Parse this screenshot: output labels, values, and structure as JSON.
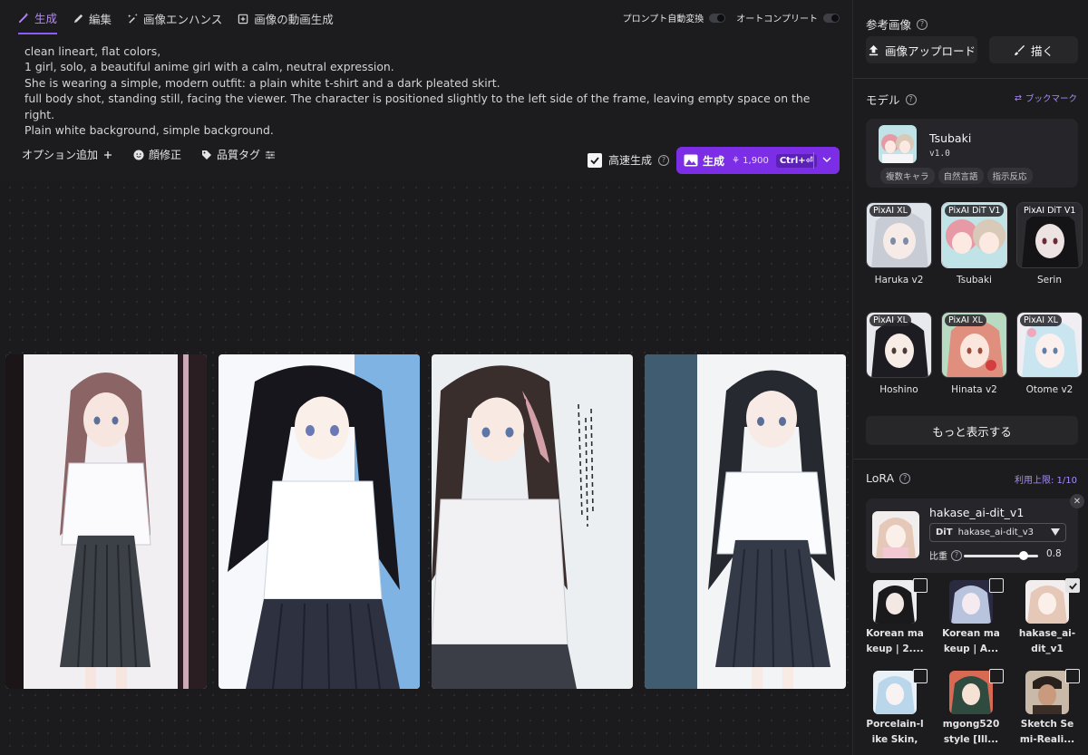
{
  "tabs": [
    {
      "label": "生成",
      "icon": "magic-wand-icon",
      "active": true
    },
    {
      "label": "編集",
      "icon": "pencil-icon",
      "active": false
    },
    {
      "label": "画像エンハンス",
      "icon": "sparkle-wand-icon",
      "active": false
    },
    {
      "label": "画像の動画生成",
      "icon": "video-plus-icon",
      "active": false
    }
  ],
  "toggles": {
    "prompt_auto": {
      "label": "プロンプト自動変換",
      "on": false
    },
    "autocomplete": {
      "label": "オートコンプリート",
      "on": false
    }
  },
  "prompt": {
    "text": "clean lineart, flat colors,\n1 girl, solo, a beautiful anime girl with a calm, neutral expression.\nShe is wearing a simple, modern outfit: a plain white t-shirt and a dark pleated skirt.\nfull body shot, standing still, facing the viewer. The character is positioned slightly to the left side of the frame, leaving empty space on the right.\nPlain white background, simple background."
  },
  "options": {
    "add_option": "オプション追加",
    "face_fix": "顔修正",
    "quality_tag": "品質タグ"
  },
  "fast_gen": {
    "label": "高速生成",
    "checked": true
  },
  "generate": {
    "label": "生成",
    "cost": "1,900",
    "shortcut": "Ctrl+⏎"
  },
  "gallery": [
    {
      "alt": "generated-image-1",
      "accent": "#2a1e22"
    },
    {
      "alt": "generated-image-2",
      "accent": "#7fb3e4"
    },
    {
      "alt": "generated-image-3",
      "accent": "#e9eaee"
    },
    {
      "alt": "generated-image-4",
      "accent": "#3f5c70"
    }
  ],
  "reference": {
    "title": "参考画像",
    "upload": "画像アップロード",
    "draw": "描く"
  },
  "model": {
    "title": "モデル",
    "bookmark": "ブックマーク",
    "selected": {
      "name": "Tsubaki",
      "version": "v1.0",
      "tags": [
        "複数キャラ",
        "自然言語",
        "指示反応"
      ]
    },
    "items": [
      {
        "badge": "PixAI XL",
        "name": "Haruka v2",
        "hair": "#c8ccd4",
        "bg": "#dfe3ea"
      },
      {
        "badge": "PixAI DiT V1",
        "name": "Tsubaki",
        "hair": "#e79aa6",
        "bg": "#bfe3e6"
      },
      {
        "badge": "PixAI DiT V1",
        "name": "Serin",
        "hair": "#141416",
        "bg": "#2b2b30"
      },
      {
        "badge": "PixAI XL",
        "name": "Hoshino",
        "hair": "#1d1c22",
        "bg": "#e8e9ec"
      },
      {
        "badge": "PixAI XL",
        "name": "Hinata v2",
        "hair": "#e08e7d",
        "bg": "#b8d9c2"
      },
      {
        "badge": "PixAI XL",
        "name": "Otome v2",
        "hair": "#c9e6f0",
        "bg": "#f0eef2"
      }
    ],
    "show_more": "もっと表示する"
  },
  "lora": {
    "title": "LoRA",
    "limit": "利用上限: 1/10",
    "selected": {
      "name": "hakase_ai-dit_v1",
      "tag": "DiT",
      "version": "hakase_ai-dit_v3",
      "weight_label": "比重",
      "weight": 0.8
    },
    "items": [
      {
        "name": "Korean ma keup | 2....",
        "line1": "Korean ma",
        "line2": "keup | 2....",
        "checked": false,
        "hair": "#1a1a1d",
        "bg": "#ededf0"
      },
      {
        "name": "Korean ma keup | A...",
        "line1": "Korean ma",
        "line2": "keup | A...",
        "checked": false,
        "hair": "#b8c4de",
        "bg": "#2a2a40"
      },
      {
        "name": "hakase_ai-dit_v1",
        "line1": "hakase_ai-",
        "line2": "dit_v1",
        "checked": true,
        "hair": "#e6c8b8",
        "bg": "#f3eeee"
      },
      {
        "name": "Porcelain-like Skin, ...",
        "line1": "Porcelain-l",
        "line2": "ike Skin, ...",
        "checked": false,
        "hair": "#b9d6ea",
        "bg": "#e9f1f7"
      },
      {
        "name": "mgong520 style [Ill...",
        "line1": "mgong520",
        "line2": "style [Ill...",
        "checked": false,
        "hair": "#2f4a3f",
        "bg": "#d86a54"
      },
      {
        "name": "Sketch Semi-Reali...",
        "line1": "Sketch Se",
        "line2": "mi-Reali...",
        "checked": false,
        "hair": "#2a211c",
        "bg": "#c9b9a9"
      }
    ]
  }
}
